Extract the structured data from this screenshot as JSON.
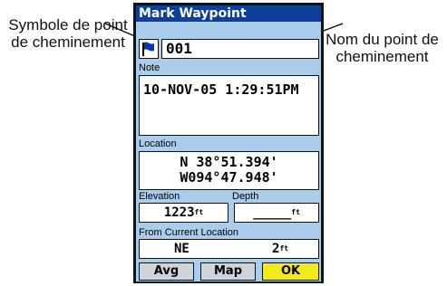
{
  "callouts": {
    "left": "Symbole de point de cheminement",
    "right": "Nom du point de cheminement"
  },
  "window": {
    "title": "Mark Waypoint"
  },
  "waypoint": {
    "symbol_icon": "blue-flag-icon",
    "name": "001"
  },
  "note": {
    "label": "Note",
    "value": "10-NOV-05 1:29:51PM"
  },
  "location": {
    "label": "Location",
    "line1": "N  38°51.394'",
    "line2": "W094°47.948'"
  },
  "elevation": {
    "label": "Elevation",
    "value": "1223",
    "unit": "ft"
  },
  "depth": {
    "label": "Depth",
    "value": "_____",
    "unit": "ft"
  },
  "from_current": {
    "label": "From Current Location",
    "bearing": "NE",
    "distance": "2",
    "unit": "ft"
  },
  "buttons": {
    "avg": "Avg",
    "map": "Map",
    "ok": "OK"
  },
  "colors": {
    "titlebar": "#0d3f9c",
    "screen_bg": "#a9cdea",
    "ok_button": "#f2ec1c",
    "flag": "#0a35b8"
  }
}
